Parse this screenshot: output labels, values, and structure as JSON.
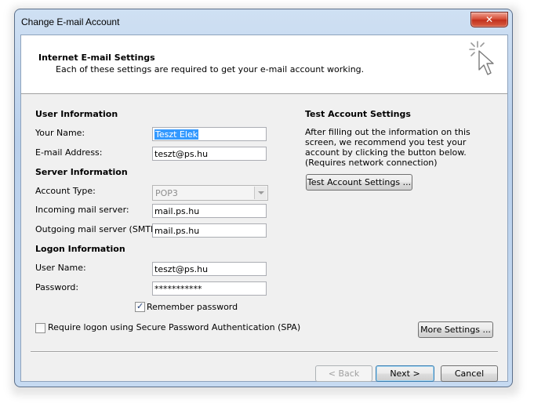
{
  "window": {
    "title": "Change E-mail Account",
    "close_glyph": "✕"
  },
  "header": {
    "title": "Internet E-mail Settings",
    "subtitle": "Each of these settings are required to get your e-mail account working.",
    "icon": "cursor-sparkle-icon"
  },
  "user_info": {
    "heading": "User Information",
    "name_label": "Your Name:",
    "name_value": "Teszt Elek",
    "email_label": "E-mail Address:",
    "email_value": "teszt@ps.hu"
  },
  "server_info": {
    "heading": "Server Information",
    "account_type_label": "Account Type:",
    "account_type_value": "POP3",
    "incoming_label": "Incoming mail server:",
    "incoming_value": "mail.ps.hu",
    "outgoing_label": "Outgoing mail server (SMTP):",
    "outgoing_value": "mail.ps.hu"
  },
  "logon_info": {
    "heading": "Logon Information",
    "username_label": "User Name:",
    "username_value": "teszt@ps.hu",
    "password_label": "Password:",
    "password_value": "***********",
    "remember_label": "Remember password",
    "remember_checked": true,
    "spa_label": "Require logon using Secure Password Authentication (SPA)",
    "spa_checked": false
  },
  "test": {
    "heading": "Test Account Settings",
    "description": "After filling out the information on this screen, we recommend you test your account by clicking the button below. (Requires network connection)",
    "button": "Test Account Settings ..."
  },
  "buttons": {
    "more_settings": "More Settings ...",
    "back": "< Back",
    "next": "Next >",
    "cancel": "Cancel"
  }
}
